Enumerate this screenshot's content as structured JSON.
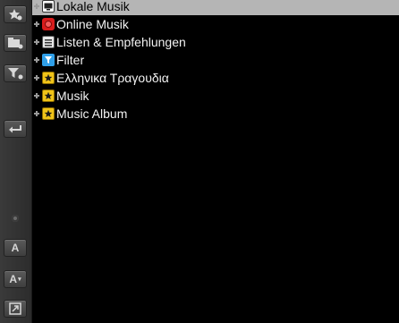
{
  "toolbar": {
    "buttons": [
      {
        "name": "favorites-add-icon"
      },
      {
        "name": "folder-add-icon"
      },
      {
        "name": "filter-add-icon"
      },
      {
        "name": "back-icon"
      },
      {
        "name": "font-size-label",
        "label": "A"
      },
      {
        "name": "font-size-dropdown",
        "label": "A"
      },
      {
        "name": "pop-out-icon"
      }
    ]
  },
  "tree": {
    "items": [
      {
        "label": "Lokale Musik",
        "icon": "monitor-icon",
        "selected": true
      },
      {
        "label": "Online Musik",
        "icon": "online-music-icon"
      },
      {
        "label": "Listen & Empfehlungen",
        "icon": "list-icon"
      },
      {
        "label": "Filter",
        "icon": "filter-icon"
      },
      {
        "label": "Ελληνικα Τραγουδια",
        "icon": "star-folder-icon"
      },
      {
        "label": "Musik",
        "icon": "star-folder-icon"
      },
      {
        "label": "Music Album",
        "icon": "star-folder-icon"
      }
    ]
  },
  "colors": {
    "selection_bg": "#b5b5b5",
    "tree_bg": "#000000",
    "text": "#f2f2f2",
    "toolbar_bg": "#333333"
  }
}
